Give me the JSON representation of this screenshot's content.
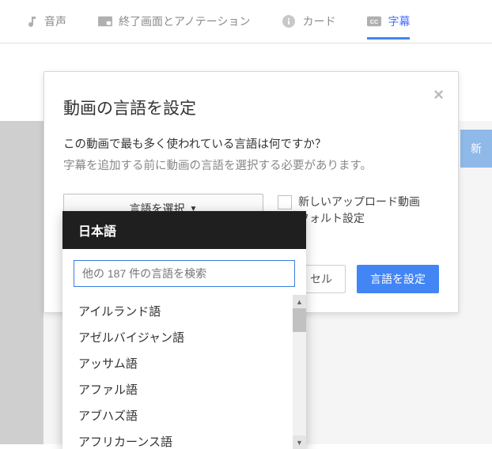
{
  "tabs": {
    "audio": "音声",
    "endscreen": "終了画面とアノテーション",
    "cards": "カード",
    "subtitles": "字幕"
  },
  "sideButton": "新",
  "modal": {
    "title": "動画の言語を設定",
    "question": "この動画で最も多く使われている言語は何ですか？",
    "sub": "字幕を追加する前に動画の言語を選択する必要があります。",
    "selectLabel": "言語を選択",
    "caret": "▼",
    "checkboxLine1": "新しいアップロード動画",
    "checkboxLine2": "フォルト設定",
    "cancel": "セル",
    "confirm": "言語を設定",
    "close": "×"
  },
  "dropdown": {
    "header": "日本語",
    "searchPlaceholder": "他の 187 件の言語を検索",
    "items": [
      "アイルランド語",
      "アゼルバイジャン語",
      "アッサム語",
      "アファル語",
      "アブハズ語",
      "アフリカーンス語"
    ],
    "scrollUp": "▲",
    "scrollDown": "▼"
  }
}
